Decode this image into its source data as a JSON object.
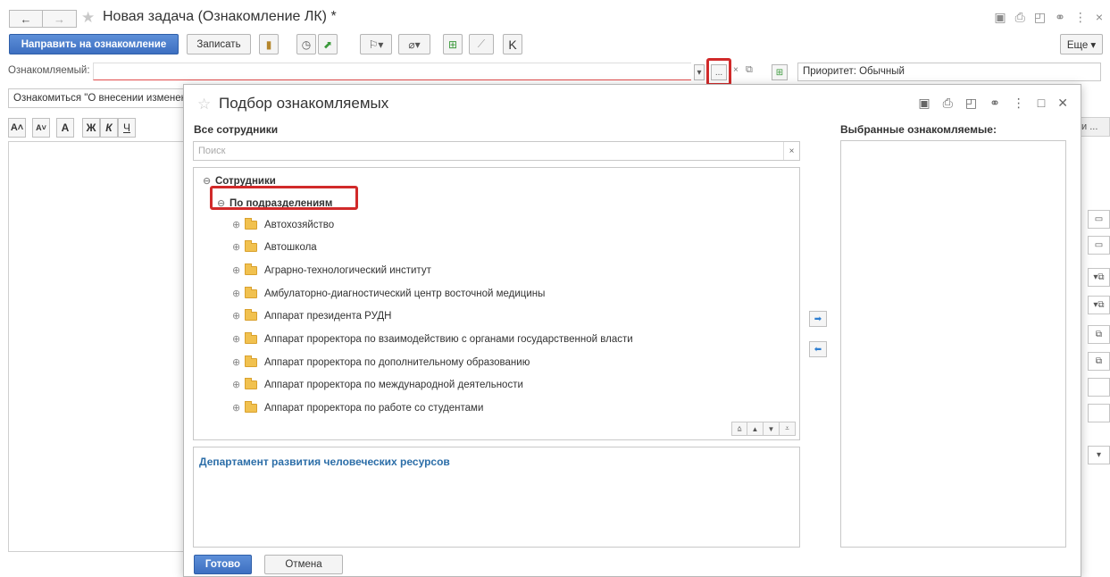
{
  "window": {
    "title": "Новая задача (Ознакомление ЛК) *",
    "back_glyph": "←",
    "forward_glyph": "→"
  },
  "toolbar": {
    "send_label": "Направить на ознакомление",
    "save_label": "Записать",
    "k_label": "K",
    "more_label": "Еще ▾"
  },
  "form": {
    "ozn_label": "Ознакомляемый:",
    "ozn_value": "",
    "dots_label": "...",
    "priority_value": "Приоритет: Обычный",
    "subject_value": "Ознакомиться \"О внесении изменен",
    "fmt_labels": [
      "A˄",
      "A˅",
      "A",
      "Ж",
      "К",
      "Ч"
    ],
    "right_header": "и ..."
  },
  "dialog": {
    "title": "Подбор ознакомляемых",
    "all_employees_label": "Все сотрудники",
    "selected_label": "Выбранные ознакомляемые:",
    "search_placeholder": "Поиск",
    "tree": {
      "root": "Сотрудники",
      "group": "По подразделениям",
      "items": [
        "Автохозяйство",
        "Автошкола",
        "Аграрно-технологический институт",
        "Амбулаторно-диагностический центр восточной медицины",
        "Аппарат президента РУДН",
        "Аппарат проректора по взаимодействию с органами государственной власти",
        "Аппарат проректора по дополнительному образованию",
        "Аппарат проректора по международной деятельности",
        "Аппарат проректора по работе со студентами"
      ]
    },
    "description": "Департамент развития человеческих ресурсов",
    "ok_label": "Готово",
    "cancel_label": "Отмена"
  },
  "colors": {
    "accent_blue": "#3d6fc1",
    "highlight_red": "#d12a2a",
    "link_blue": "#2c6ea8",
    "folder_yellow": "#f1c14f"
  }
}
